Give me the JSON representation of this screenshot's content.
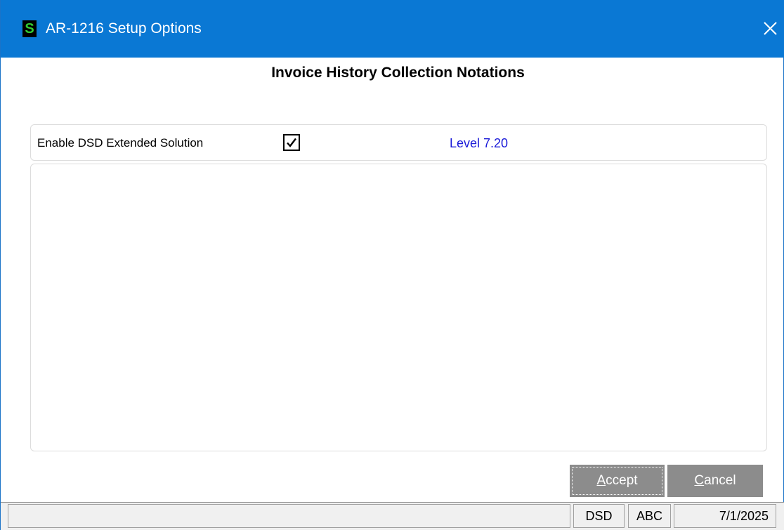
{
  "window": {
    "title": "AR-1216 Setup Options",
    "app_icon_letter": "S",
    "icon": "close-icon"
  },
  "dialog": {
    "heading": "Invoice History Collection Notations",
    "option": {
      "label": "Enable DSD Extended Solution",
      "checked": true,
      "level": "Level  7.20"
    }
  },
  "buttons": {
    "accept_hotkey": "A",
    "accept_rest": "ccept",
    "cancel_hotkey": "C",
    "cancel_rest": "ancel"
  },
  "statusbar": {
    "main": "",
    "company_code": "DSD",
    "company_abbrev": "ABC",
    "date": "7/1/2025"
  },
  "colors": {
    "titlebar": "#0a78d4",
    "level_text": "#1a1ad8",
    "button_bg": "#8c8c8c"
  }
}
